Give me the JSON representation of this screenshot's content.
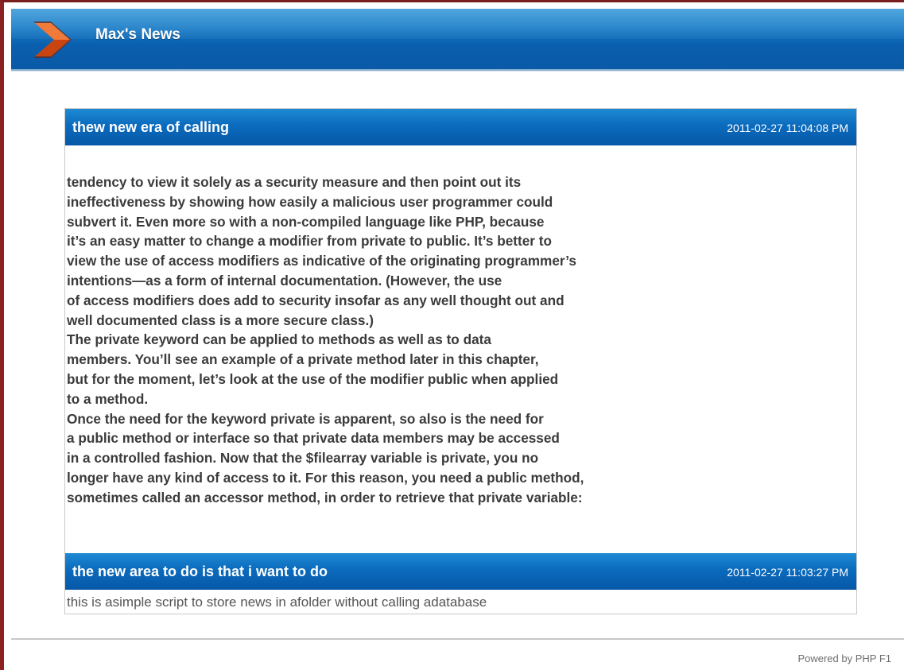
{
  "site": {
    "title": "Max's News",
    "logo_icon": "orange-chevron-icon",
    "colors": {
      "header_blue": "#0a5fae",
      "news_header_blue": "#0b6bbd",
      "frame_red": "#8a2222",
      "logo_orange": "#e8581c"
    }
  },
  "news": [
    {
      "title": "thew new era of calling",
      "date": "2011-02-27 11:04:08 PM",
      "body_lines": [
        "tendency to view it solely as a security measure and then point out its",
        "ineffectiveness by showing how easily a malicious user programmer could",
        "subvert it. Even more so with a non-compiled language like PHP, because",
        "it’s an easy matter to change a modifier from private to public. It’s better to",
        "view the use of access modifiers as indicative of the originating programmer’s",
        "intentions—as a form of internal documentation. (However, the use",
        "of access modifiers does add to security insofar as any well thought out and",
        "well documented class is a more secure class.)",
        "The private keyword can be applied to methods as well as to data",
        "members. You’ll see an example of a private method later in this chapter,",
        "but for the moment, let’s look at the use of the modifier public when applied",
        "to a method.",
        "Once the need for the keyword private is apparent, so also is the need for",
        "a public method or interface so that private data members may be accessed",
        "in a controlled fashion. Now that the $filearray variable is private, you no",
        "longer have any kind of access to it. For this reason, you need a public method,",
        "sometimes called an accessor method, in order to retrieve that private variable:"
      ]
    },
    {
      "title": "the new area to do is that i want to do",
      "date": "2011-02-27 11:03:27 PM",
      "body": "this is asimple script to store news in afolder without calling adatabase"
    }
  ],
  "footer": {
    "text": "Powered by PHP F1"
  }
}
